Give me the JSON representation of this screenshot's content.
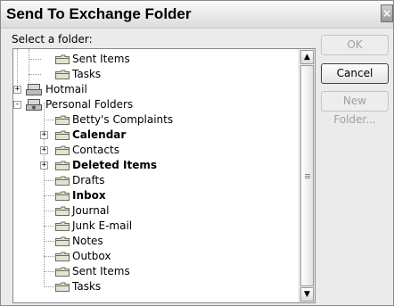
{
  "window": {
    "title": "Send To Exchange Folder"
  },
  "prompt_label": "Select a folder:",
  "buttons": {
    "ok": "OK",
    "cancel": "Cancel",
    "new_folder": "New Folder..."
  },
  "tree": {
    "items": [
      {
        "label": "Sent Items",
        "bold": false
      },
      {
        "label": "Tasks",
        "bold": false
      },
      {
        "label": "Hotmail",
        "bold": false,
        "expander": "+"
      },
      {
        "label": "Personal Folders",
        "bold": false,
        "expander": "-"
      },
      {
        "label": "Betty's Complaints",
        "bold": false
      },
      {
        "label": "Calendar",
        "bold": true,
        "expander": "+"
      },
      {
        "label": "Contacts",
        "bold": false,
        "expander": "+"
      },
      {
        "label": "Deleted Items",
        "bold": true,
        "expander": "+"
      },
      {
        "label": "Drafts",
        "bold": false
      },
      {
        "label": "Inbox",
        "bold": true
      },
      {
        "label": "Journal",
        "bold": false
      },
      {
        "label": "Junk E-mail",
        "bold": false
      },
      {
        "label": "Notes",
        "bold": false
      },
      {
        "label": "Outbox",
        "bold": false
      },
      {
        "label": "Sent Items",
        "bold": false
      },
      {
        "label": "Tasks",
        "bold": false
      }
    ]
  },
  "icons": {
    "close": "close-icon",
    "folder": "folder-icon",
    "store": "mail-store-icon",
    "scroll_up": "scroll-up-arrow-icon",
    "scroll_down": "scroll-down-arrow-icon"
  }
}
